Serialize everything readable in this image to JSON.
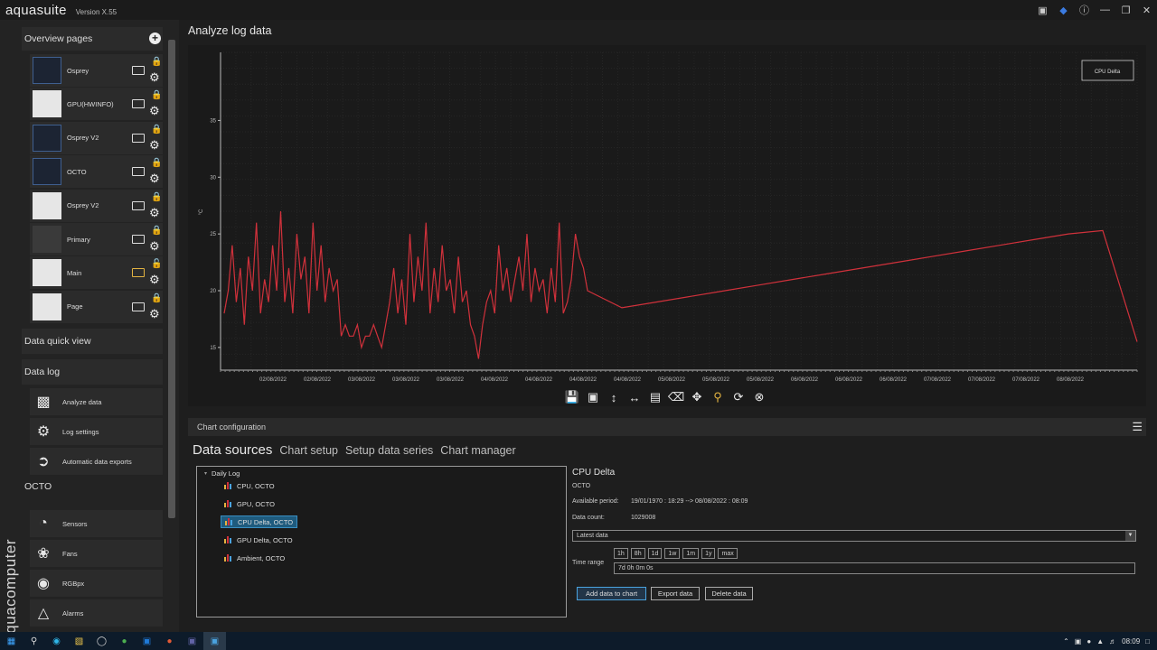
{
  "app": {
    "logo": "aquasuite",
    "version": "Version X.55",
    "brand_vertical": "aquacomputer"
  },
  "sidebar": {
    "overview_header": "Overview pages",
    "overview_items": [
      {
        "label": "Osprey",
        "lock": "locked"
      },
      {
        "label": "GPU(HWINFO)",
        "lock": "locked"
      },
      {
        "label": "Osprey V2",
        "lock": "locked"
      },
      {
        "label": "OCTO",
        "lock": "locked"
      },
      {
        "label": "Osprey V2",
        "lock": "locked"
      },
      {
        "label": "Primary",
        "lock": "locked"
      },
      {
        "label": "Main",
        "lock": "unlocked-highlighted"
      },
      {
        "label": "Page",
        "lock": "locked"
      }
    ],
    "quick_view": "Data quick view",
    "data_log": "Data log",
    "data_log_items": [
      {
        "label": "Analyze data",
        "icon": "bar-chart-icon"
      },
      {
        "label": "Log settings",
        "icon": "gear-icon"
      },
      {
        "label": "Automatic data exports",
        "icon": "export-icon"
      }
    ],
    "octo_header": "OCTO",
    "octo_items": [
      {
        "label": "Sensors",
        "icon": "gauge-icon"
      },
      {
        "label": "Fans",
        "icon": "fan-icon"
      },
      {
        "label": "RGBpx",
        "icon": "bulb-icon"
      },
      {
        "label": "Alarms",
        "icon": "alarm-icon"
      }
    ]
  },
  "main": {
    "title": "Analyze log data"
  },
  "chart_data": {
    "type": "line",
    "legend": [
      "CPU Delta"
    ],
    "legend_position": "top-right",
    "ylabel": "°C",
    "y_ticks": [
      "15",
      "20",
      "25",
      "30",
      "35"
    ],
    "ylim": [
      13,
      41
    ],
    "x_ticks": [
      "02/08/2022",
      "02/08/2022",
      "03/08/2022",
      "03/08/2022",
      "03/08/2022",
      "04/08/2022",
      "04/08/2022",
      "04/08/2022",
      "04/08/2022",
      "05/08/2022",
      "05/08/2022",
      "05/08/2022",
      "06/08/2022",
      "06/08/2022",
      "06/08/2022",
      "07/08/2022",
      "07/08/2022",
      "07/08/2022",
      "08/08/2022"
    ],
    "series": [
      {
        "name": "CPU Delta",
        "color": "#d0313b",
        "y_values": [
          18,
          20,
          24,
          19,
          22,
          17,
          23,
          20,
          26,
          18,
          21,
          19,
          24,
          20,
          27,
          19,
          22,
          18,
          25,
          21,
          23,
          18,
          26,
          20,
          24,
          19,
          22,
          20,
          21,
          16,
          17,
          16,
          16,
          17,
          15,
          16,
          16,
          17,
          16,
          15,
          17,
          19,
          22,
          18,
          21,
          17,
          25,
          19,
          23,
          20,
          26,
          18,
          22,
          19,
          24,
          20,
          21,
          18,
          23,
          19,
          20,
          17,
          16,
          14,
          17,
          19,
          20,
          18,
          24,
          20,
          22,
          19,
          21,
          23,
          20,
          25,
          19,
          22,
          20,
          21,
          18,
          22,
          19,
          26,
          18,
          19,
          21,
          25,
          23,
          22,
          20,
          18.5,
          19,
          19.5,
          20,
          20.5,
          21,
          21.5,
          22,
          22.5,
          23,
          23.5,
          24,
          24.5,
          25,
          25.3,
          15.5
        ]
      }
    ],
    "grid": true
  },
  "chart_toolbar": [
    "save-icon",
    "camera-icon",
    "fit-vertical-icon",
    "fit-horizontal-icon",
    "document-icon",
    "clear-icon",
    "pan-icon",
    "zoom-icon",
    "refresh-icon",
    "close-circle-icon"
  ],
  "config": {
    "header": "Chart configuration",
    "tabs": [
      "Data sources",
      "Chart setup",
      "Setup data series",
      "Chart manager"
    ],
    "tree": {
      "root": "Daily Log",
      "items": [
        "CPU, OCTO",
        "GPU, OCTO",
        "CPU Delta, OCTO",
        "GPU Delta, OCTO",
        "Ambient, OCTO"
      ],
      "selected_index": 2
    },
    "detail": {
      "name": "CPU Delta",
      "device": "OCTO",
      "available_label": "Available period:",
      "available_value": "19/01/1970 : 18:29 --> 08/08/2022 : 08:09",
      "count_label": "Data count:",
      "count_value": "1029008",
      "select_value": "Latest data",
      "time_buttons": [
        "1h",
        "8h",
        "1d",
        "1w",
        "1m",
        "1y",
        "max"
      ],
      "time_range_label": "Time range",
      "time_range_value": "7d 0h 0m 0s",
      "add_button": "Add data to chart",
      "export_button": "Export data",
      "delete_button": "Delete data"
    }
  },
  "taskbar": {
    "time": "08:09"
  }
}
